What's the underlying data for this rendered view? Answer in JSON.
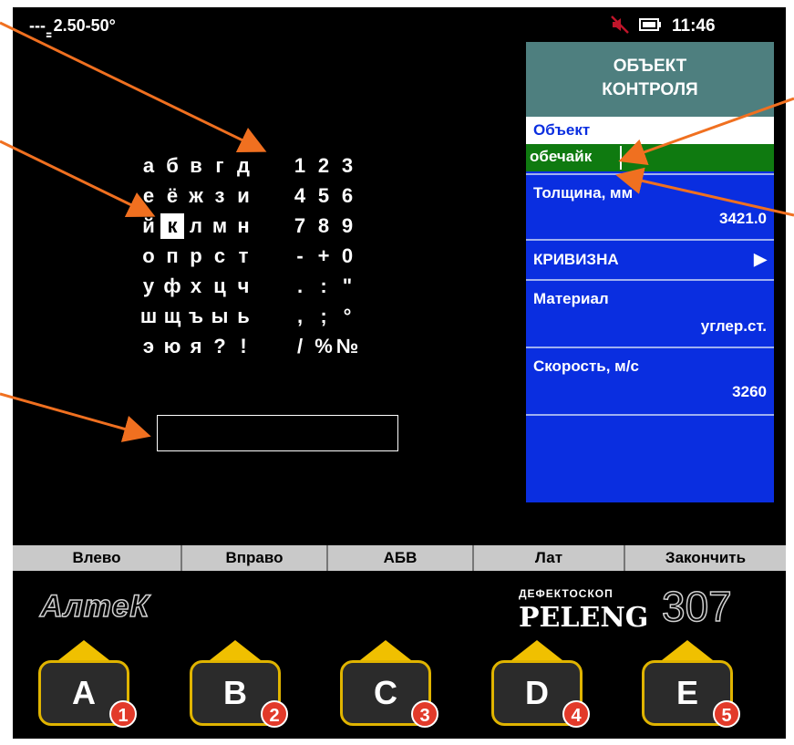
{
  "status_bar": {
    "left_text": "--- ̳ 2.50-50°",
    "time": "11:46",
    "mute_icon": "muted-speaker-icon",
    "battery_icon": "battery-icon"
  },
  "keyboard": {
    "rows": [
      [
        "а",
        "б",
        "в",
        "г",
        "д",
        " ",
        "1",
        "2",
        "3"
      ],
      [
        "е",
        "ё",
        "ж",
        "з",
        "и",
        " ",
        "4",
        "5",
        "6"
      ],
      [
        "й",
        "к",
        "л",
        "м",
        "н",
        " ",
        "7",
        "8",
        "9"
      ],
      [
        "о",
        "п",
        "р",
        "с",
        "т",
        " ",
        "-",
        "+",
        "0"
      ],
      [
        "у",
        "ф",
        "х",
        "ц",
        "ч",
        " ",
        ".",
        ":",
        "\""
      ],
      [
        "ш",
        "щ",
        "ъ",
        "ы",
        "ь",
        " ",
        ",",
        ";",
        "°"
      ],
      [
        "э",
        "ю",
        "я",
        "?",
        "!",
        " ",
        "/",
        "%",
        "№"
      ]
    ],
    "selected": "к",
    "text_entry_value": ""
  },
  "panel": {
    "header_line1": "ОБЪЕКТ",
    "header_line2": "КОНТРОЛЯ",
    "object_label": "Объект",
    "object_value": "обечайк",
    "thickness_label": "Толщина, мм",
    "thickness_value": "3421.0",
    "curvature_label": "КРИВИЗНА",
    "curvature_arrow": "▶",
    "material_label": "Материал",
    "material_value": "углер.ст.",
    "speed_label": "Скорость, м/с",
    "speed_value": "3260"
  },
  "softkeys": [
    "Влево",
    "Вправо",
    "АБВ",
    "Лат",
    "Закончить"
  ],
  "brand": {
    "left_logo": "АлтеК",
    "small_text": "ДЕФЕКТОСКОП",
    "name": "PELENG",
    "model": "307"
  },
  "hardware_buttons": [
    {
      "letter": "A",
      "number": "1"
    },
    {
      "letter": "B",
      "number": "2"
    },
    {
      "letter": "C",
      "number": "3"
    },
    {
      "letter": "D",
      "number": "4"
    },
    {
      "letter": "E",
      "number": "5"
    }
  ],
  "colors": {
    "panel_blue": "#0a2ee0",
    "header_teal": "#4e7f7f",
    "field_green": "#0f7a10",
    "annotation_orange": "#f07020",
    "button_yellow": "#f0c000",
    "badge_red": "#e23a2a"
  }
}
